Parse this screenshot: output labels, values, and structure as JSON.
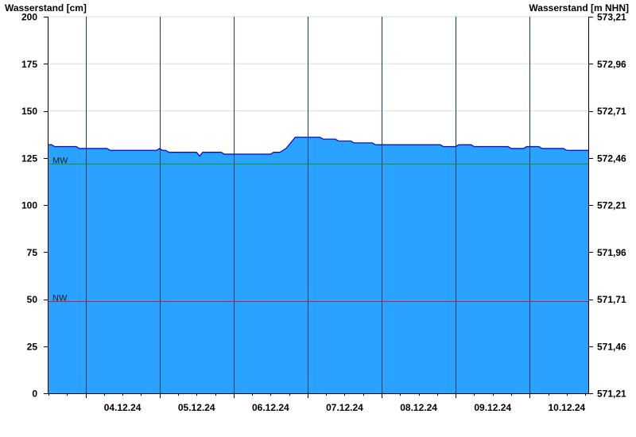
{
  "chart_data": {
    "type": "area",
    "left_axis_title": "Wasserstand [cm]",
    "right_axis_title": "Wasserstand [m NHN]",
    "y_range": [
      0,
      200
    ],
    "y_ticks": [
      0,
      25,
      50,
      75,
      100,
      125,
      150,
      175,
      200
    ],
    "y_tick_labels": [
      "0",
      "25",
      "50",
      "75",
      "100",
      "125",
      "150",
      "175",
      "200"
    ],
    "right_tick_labels": [
      "571,21",
      "571,46",
      "571,71",
      "571,96",
      "572,21",
      "572,46",
      "572,71",
      "572,96",
      "573,21"
    ],
    "x_range_days": [
      "03.12.24 12:00",
      "10.12.24 19:00"
    ],
    "day_boundaries": [
      "04.12.24 00:00",
      "05.12.24 00:00",
      "06.12.24 00:00",
      "07.12.24 00:00",
      "08.12.24 00:00",
      "09.12.24 00:00",
      "10.12.24 00:00"
    ],
    "x_tick_labels": [
      {
        "date": "04.12.24 12:00",
        "label": "04.12.24"
      },
      {
        "date": "05.12.24 12:00",
        "label": "05.12.24"
      },
      {
        "date": "06.12.24 12:00",
        "label": "06.12.24"
      },
      {
        "date": "07.12.24 12:00",
        "label": "07.12.24"
      },
      {
        "date": "08.12.24 12:00",
        "label": "08.12.24"
      },
      {
        "date": "09.12.24 12:00",
        "label": "09.12.24"
      },
      {
        "date": "10.12.24 12:00",
        "label": "10.12.24"
      }
    ],
    "series": [
      {
        "color": "#29a3ff",
        "line_color": "#0000cc",
        "points": [
          [
            "03.12.24 12:00",
            132
          ],
          [
            "03.12.24 13:00",
            132
          ],
          [
            "03.12.24 14:00",
            131
          ],
          [
            "03.12.24 21:00",
            131
          ],
          [
            "03.12.24 22:00",
            130
          ],
          [
            "04.12.24 07:00",
            130
          ],
          [
            "04.12.24 08:00",
            129
          ],
          [
            "04.12.24 23:00",
            129
          ],
          [
            "05.12.24 00:00",
            130
          ],
          [
            "05.12.24 01:00",
            129
          ],
          [
            "05.12.24 02:00",
            129
          ],
          [
            "05.12.24 03:00",
            128
          ],
          [
            "05.12.24 12:00",
            128
          ],
          [
            "05.12.24 13:00",
            126
          ],
          [
            "05.12.24 14:00",
            128
          ],
          [
            "05.12.24 20:00",
            128
          ],
          [
            "05.12.24 21:00",
            127
          ],
          [
            "06.12.24 12:00",
            127
          ],
          [
            "06.12.24 13:00",
            128
          ],
          [
            "06.12.24 15:00",
            128
          ],
          [
            "06.12.24 16:00",
            129
          ],
          [
            "06.12.24 17:00",
            130
          ],
          [
            "06.12.24 18:00",
            132
          ],
          [
            "06.12.24 19:00",
            134
          ],
          [
            "06.12.24 20:00",
            136
          ],
          [
            "07.12.24 04:00",
            136
          ],
          [
            "07.12.24 05:00",
            135
          ],
          [
            "07.12.24 09:00",
            135
          ],
          [
            "07.12.24 10:00",
            134
          ],
          [
            "07.12.24 14:00",
            134
          ],
          [
            "07.12.24 15:00",
            133
          ],
          [
            "07.12.24 21:00",
            133
          ],
          [
            "07.12.24 22:00",
            132
          ],
          [
            "08.12.24 19:00",
            132
          ],
          [
            "08.12.24 20:00",
            131
          ],
          [
            "09.12.24 00:00",
            131
          ],
          [
            "09.12.24 01:00",
            132
          ],
          [
            "09.12.24 05:00",
            132
          ],
          [
            "09.12.24 06:00",
            131
          ],
          [
            "09.12.24 17:00",
            131
          ],
          [
            "09.12.24 18:00",
            130
          ],
          [
            "09.12.24 22:00",
            130
          ],
          [
            "09.12.24 23:00",
            131
          ],
          [
            "10.12.24 03:00",
            131
          ],
          [
            "10.12.24 04:00",
            130
          ],
          [
            "10.12.24 11:00",
            130
          ],
          [
            "10.12.24 12:00",
            129
          ],
          [
            "10.12.24 19:00",
            129
          ]
        ]
      }
    ],
    "reference_lines": [
      {
        "label": "MW",
        "value": 122,
        "color": "#1f8f1f"
      },
      {
        "label": "NW",
        "value": 49,
        "color": "#d62020"
      }
    ],
    "grid": {
      "horizontal": true,
      "vertical_day_lines": true
    }
  }
}
